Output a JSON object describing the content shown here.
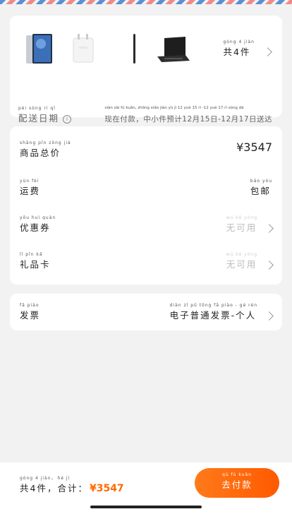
{
  "products": {
    "items": [
      {
        "name": "tablet-image"
      },
      {
        "name": "charger-image"
      },
      {
        "name": "stylus-image"
      },
      {
        "name": "keyboard-case-image"
      }
    ],
    "count_pinyin": "gòng 4 jiàn",
    "count_label": "共4件"
  },
  "shipping": {
    "label_pinyin": "pèi sòng rì qī",
    "label": "配送日期",
    "value_pinyin": "xiàn zài fù kuǎn, zhōng xiǎo jiàn yù jì 12 yuè 15 rì -12 yuè 17 rì sòng dá",
    "value": "现在付款，中小件预计12月15日-12月17日送达"
  },
  "summary": {
    "total_pinyin": "shāng pǐn zǒng jià",
    "total_label": "商品总价",
    "total_value": "¥3547",
    "freight_pinyin": "yùn fèi",
    "freight_label": "运费",
    "freight_value_pinyin": "bāo yóu",
    "freight_value": "包邮",
    "coupon_pinyin": "yōu huì quàn",
    "coupon_label": "优惠券",
    "coupon_value_pinyin": "wú kě yòng",
    "coupon_value": "无可用",
    "gift_pinyin": "lǐ pǐn kǎ",
    "gift_label": "礼品卡",
    "gift_value_pinyin": "wú kě yòng",
    "gift_value": "无可用"
  },
  "invoice": {
    "label_pinyin": "fā piào",
    "label": "发票",
    "value_pinyin": "diàn zǐ pǔ tōng fā piào - gè rén",
    "value": "电子普通发票-个人"
  },
  "footer": {
    "count_pinyin": "gòng 4 jiàn，",
    "count_label": "共4件，",
    "sum_pinyin": "hé jì",
    "sum_label": "合计：",
    "sum_value": "¥3547",
    "pay_pinyin": "qù fù kuǎn",
    "pay_label": "去付款"
  },
  "colors": {
    "accent": "#ff6a00"
  }
}
